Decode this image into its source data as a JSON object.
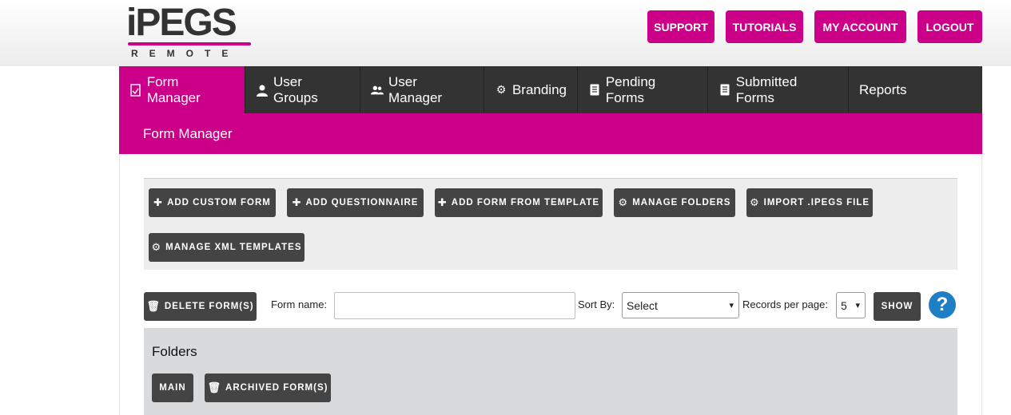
{
  "brand": {
    "logo_text": "iPEGS",
    "logo_sub": "REMOTE",
    "accent": "#cc0088"
  },
  "top_buttons": [
    {
      "label": "SUPPORT"
    },
    {
      "label": "TUTORIALS"
    },
    {
      "label": "MY ACCOUNT"
    },
    {
      "label": "LOGOUT"
    }
  ],
  "nav": [
    {
      "label": "Form Manager",
      "icon": "form-icon"
    },
    {
      "label": "User Groups",
      "icon": "user-icon"
    },
    {
      "label": "User Manager",
      "icon": "users-icon"
    },
    {
      "label": "Branding",
      "icon": "gears-icon"
    },
    {
      "label": "Pending Forms",
      "icon": "document-icon"
    },
    {
      "label": "Submitted Forms",
      "icon": "document-icon"
    },
    {
      "label": "Reports",
      "icon": ""
    }
  ],
  "subbar": {
    "title": "Form Manager"
  },
  "actions": [
    {
      "label": "ADD CUSTOM FORM",
      "icon": "plus-icon"
    },
    {
      "label": "ADD QUESTIONNAIRE",
      "icon": "plus-icon"
    },
    {
      "label": "ADD FORM FROM TEMPLATE",
      "icon": "plus-icon"
    },
    {
      "label": "MANAGE FOLDERS",
      "icon": "gears-icon"
    },
    {
      "label": "IMPORT .IPEGS FILE",
      "icon": "gears-icon"
    },
    {
      "label": "MANAGE XML TEMPLATES",
      "icon": "gears-icon"
    }
  ],
  "filters": {
    "delete_label": "DELETE FORM(S)",
    "form_name_label": "Form name:",
    "form_name_value": "",
    "sort_by_label": "Sort By:",
    "sort_by_value": "Select",
    "records_label": "Records per page:",
    "records_value": "5",
    "show_label": "SHOW",
    "help_label": "?"
  },
  "folders": {
    "title": "Folders",
    "items": [
      {
        "label": "MAIN"
      },
      {
        "label": "ARCHIVED FORM(S)"
      }
    ]
  }
}
